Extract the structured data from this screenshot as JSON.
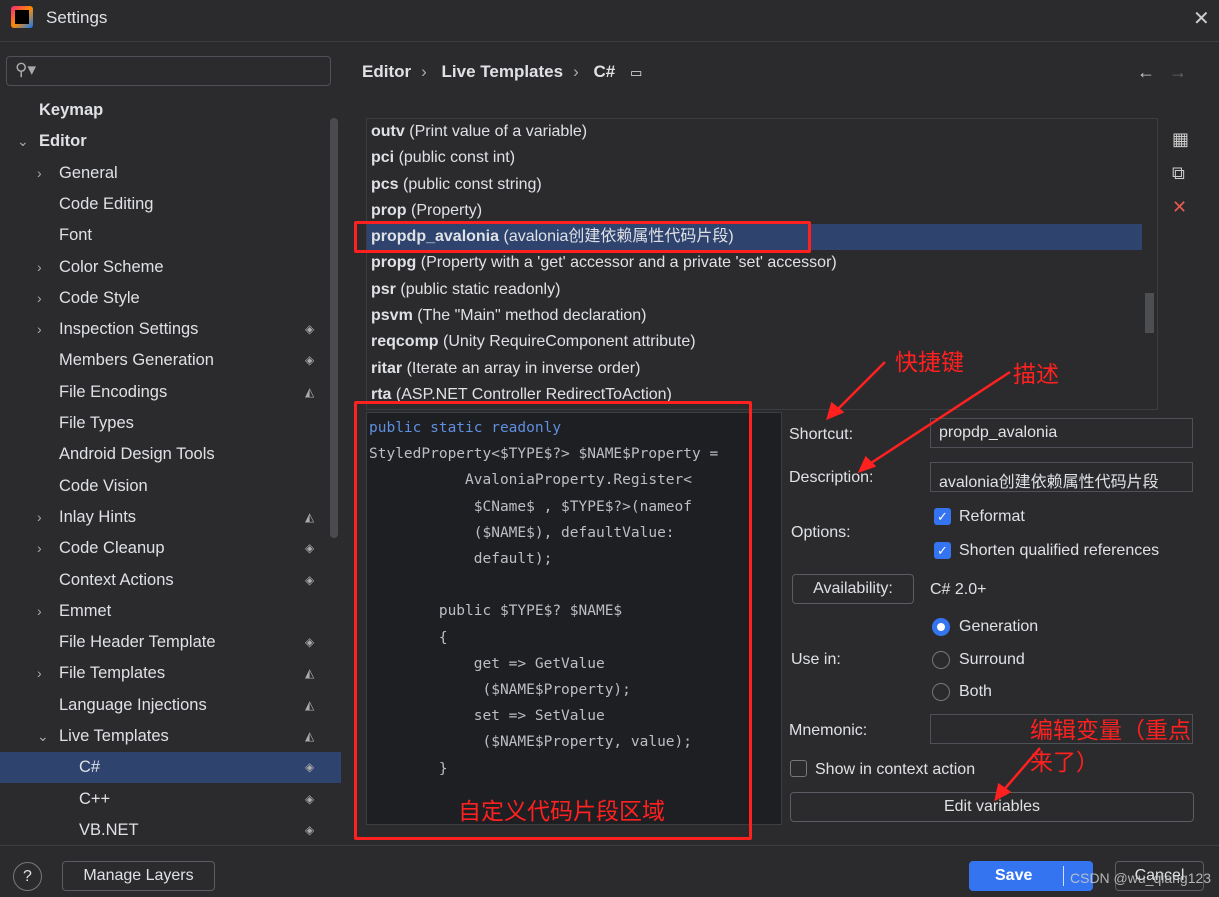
{
  "window": {
    "title": "Settings",
    "close_icon": "close-icon"
  },
  "search": {
    "placeholder": ""
  },
  "sidebar": {
    "items": [
      {
        "label": "Keymap",
        "level": 0,
        "chev": "",
        "icon": ""
      },
      {
        "label": "Editor",
        "level": 0,
        "chev": "down",
        "icon": ""
      },
      {
        "label": "General",
        "level": 1,
        "chev": "right",
        "icon": ""
      },
      {
        "label": "Code Editing",
        "level": 1,
        "chev": "",
        "icon": ""
      },
      {
        "label": "Font",
        "level": 1,
        "chev": "",
        "icon": ""
      },
      {
        "label": "Color Scheme",
        "level": 1,
        "chev": "right",
        "icon": ""
      },
      {
        "label": "Code Style",
        "level": 1,
        "chev": "right",
        "icon": ""
      },
      {
        "label": "Inspection Settings",
        "level": 1,
        "chev": "right",
        "icon": "layers"
      },
      {
        "label": "Members Generation",
        "level": 1,
        "chev": "",
        "icon": "layers"
      },
      {
        "label": "File Encodings",
        "level": 1,
        "chev": "",
        "icon": "project"
      },
      {
        "label": "File Types",
        "level": 1,
        "chev": "",
        "icon": ""
      },
      {
        "label": "Android Design Tools",
        "level": 1,
        "chev": "",
        "icon": ""
      },
      {
        "label": "Code Vision",
        "level": 1,
        "chev": "",
        "icon": ""
      },
      {
        "label": "Inlay Hints",
        "level": 1,
        "chev": "right",
        "icon": "project"
      },
      {
        "label": "Code Cleanup",
        "level": 1,
        "chev": "right",
        "icon": "layers"
      },
      {
        "label": "Context Actions",
        "level": 1,
        "chev": "",
        "icon": "layers"
      },
      {
        "label": "Emmet",
        "level": 1,
        "chev": "right",
        "icon": ""
      },
      {
        "label": "File Header Template",
        "level": 1,
        "chev": "",
        "icon": "layers"
      },
      {
        "label": "File Templates",
        "level": 1,
        "chev": "right",
        "icon": "project"
      },
      {
        "label": "Language Injections",
        "level": 1,
        "chev": "",
        "icon": "project"
      },
      {
        "label": "Live Templates",
        "level": 1,
        "chev": "down",
        "icon": "project"
      },
      {
        "label": "C#",
        "level": 2,
        "chev": "",
        "icon": "layers",
        "selected": true
      },
      {
        "label": "C++",
        "level": 2,
        "chev": "",
        "icon": "layers"
      },
      {
        "label": "VB.NET",
        "level": 2,
        "chev": "",
        "icon": "layers"
      }
    ]
  },
  "breadcrumb": [
    "Editor",
    "Live Templates",
    "C#"
  ],
  "templates": [
    {
      "key": "outv",
      "desc": "(Print value of a variable)"
    },
    {
      "key": "pci",
      "desc": "(public const int)"
    },
    {
      "key": "pcs",
      "desc": "(public const string)"
    },
    {
      "key": "prop",
      "desc": "(Property)"
    },
    {
      "key": "propdp_avalonia",
      "desc": "(avalonia创建依赖属性代码片段)",
      "selected": true
    },
    {
      "key": "propg",
      "desc": "(Property with a 'get' accessor and a private 'set' accessor)"
    },
    {
      "key": "psr",
      "desc": "(public static readonly)"
    },
    {
      "key": "psvm",
      "desc": "(The \"Main\" method declaration)"
    },
    {
      "key": "reqcomp",
      "desc": "(Unity RequireComponent attribute)"
    },
    {
      "key": "ritar",
      "desc": "(Iterate an array in inverse order)"
    },
    {
      "key": "rta",
      "desc": "(ASP.NET Controller RedirectToAction)"
    }
  ],
  "code": {
    "line1": "public static readonly",
    "rest": "StyledProperty<$TYPE$?> $NAME$Property =\n           AvaloniaProperty.Register<\n            $CName$ , $TYPE$?>(nameof\n            ($NAME$), defaultValue:\n            default);\n\n        public $TYPE$? $NAME$\n        {\n            get => GetValue\n             ($NAME$Property);\n            set => SetValue\n             ($NAME$Property, value);\n        }"
  },
  "form": {
    "shortcut_label": "Shortcut:",
    "shortcut_value": "propdp_avalonia",
    "description_label": "Description:",
    "description_value": "avalonia创建依赖属性代码片段",
    "options_label": "Options:",
    "reformat": "Reformat",
    "shorten": "Shorten qualified references",
    "availability_button": "Availability:",
    "availability_value": "C# 2.0+",
    "use_in_label": "Use in:",
    "generation": "Generation",
    "surround": "Surround",
    "both": "Both",
    "mnemonic_label": "Mnemonic:",
    "mnemonic_value": "",
    "show_context": "Show in context action",
    "edit_variables": "Edit variables"
  },
  "footer": {
    "help": "?",
    "manage_layers": "Manage Layers",
    "save": "Save",
    "cancel": "Cancel"
  },
  "annotations": {
    "shortcut": "快捷键",
    "description": "描述",
    "edit_vars": "编辑变量（重点\n来了）",
    "code_area": "自定义代码片段区域"
  },
  "watermark": "CSDN @wu_qiang123",
  "colors": {
    "accent": "#3574f0",
    "selection": "#2e436e",
    "annotation": "#ff2020"
  }
}
